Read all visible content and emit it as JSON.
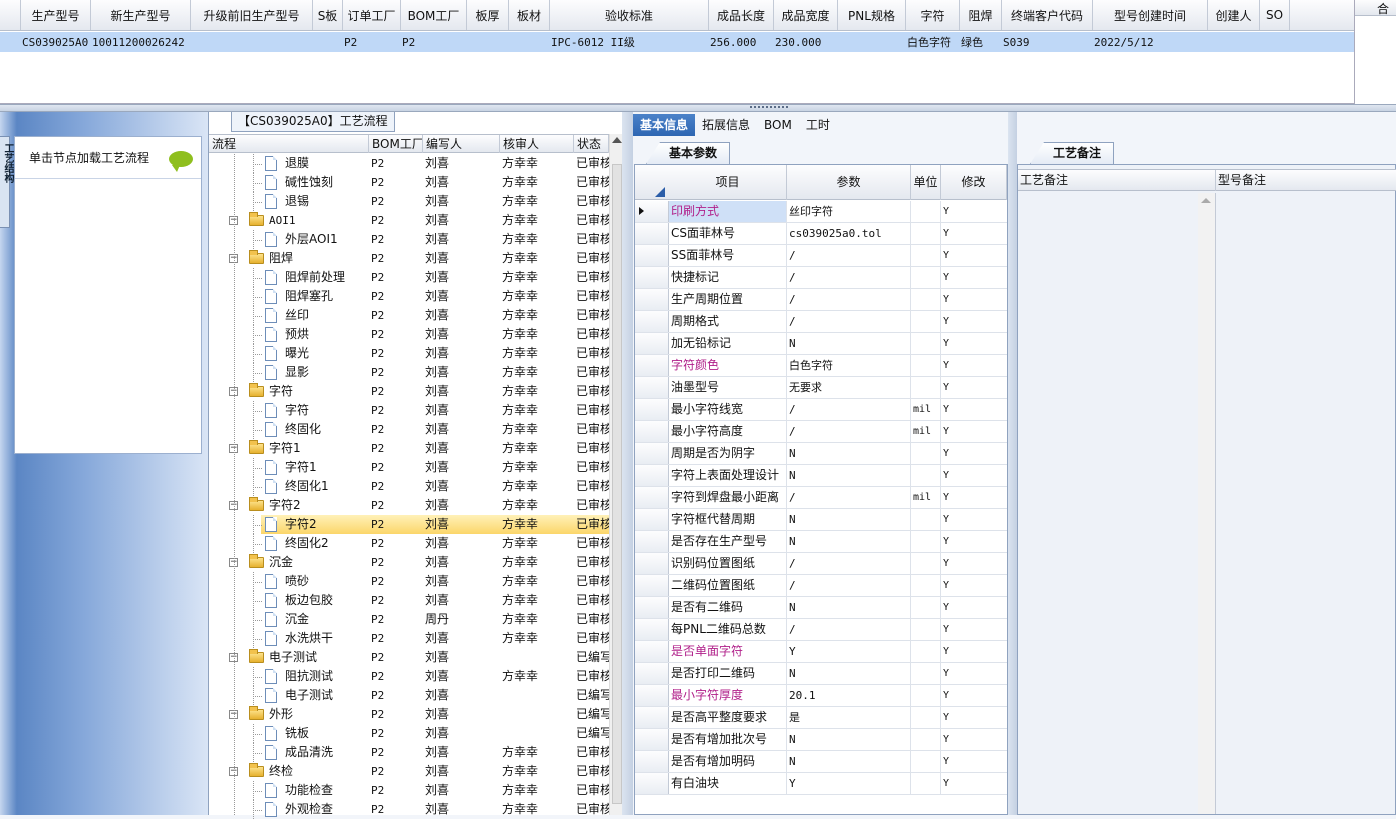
{
  "top_grid": {
    "columns": [
      "生产型号",
      "新生产型号",
      "升级前旧生产型号",
      "S板",
      "订单工厂",
      "BOM工厂",
      "板厚",
      "板材",
      "验收标准",
      "成品长度",
      "成品宽度",
      "PNL规格",
      "字符",
      "阻焊",
      "终端客户代码",
      "型号创建时间",
      "创建人",
      "SO"
    ],
    "row": [
      "CS039025A0",
      "10011200026242",
      "",
      "",
      "P2",
      "P2",
      "",
      "",
      "IPC-6012 II级",
      "256.000",
      "230.000",
      "",
      "白色字符",
      "绿色",
      "S039",
      "2022/5/12",
      "",
      ""
    ],
    "right_header": "合"
  },
  "left_panel": {
    "side_tab": "工艺结构",
    "hint": "单击节点加载工艺流程"
  },
  "tree": {
    "title": "【CS039025A0】工艺流程",
    "columns": [
      "流程",
      "BOM工厂",
      "编写人",
      "核审人",
      "状态"
    ],
    "rows": [
      {
        "level": 2,
        "type": "doc",
        "name": "退膜",
        "bom": "P2",
        "writer": "刘喜",
        "reviewer": "方幸幸",
        "status": "已审核"
      },
      {
        "level": 2,
        "type": "doc",
        "name": "碱性蚀刻",
        "bom": "P2",
        "writer": "刘喜",
        "reviewer": "方幸幸",
        "status": "已审核"
      },
      {
        "level": 2,
        "type": "doc",
        "name": "退锡",
        "bom": "P2",
        "writer": "刘喜",
        "reviewer": "方幸幸",
        "status": "已审核"
      },
      {
        "level": 1,
        "type": "folder",
        "name": "AOI1",
        "bom": "P2",
        "writer": "刘喜",
        "reviewer": "方幸幸",
        "status": "已审核"
      },
      {
        "level": 2,
        "type": "doc",
        "name": "外层AOI1",
        "bom": "P2",
        "writer": "刘喜",
        "reviewer": "方幸幸",
        "status": "已审核"
      },
      {
        "level": 1,
        "type": "folder",
        "name": "阻焊",
        "bom": "P2",
        "writer": "刘喜",
        "reviewer": "方幸幸",
        "status": "已审核"
      },
      {
        "level": 2,
        "type": "doc",
        "name": "阻焊前处理",
        "bom": "P2",
        "writer": "刘喜",
        "reviewer": "方幸幸",
        "status": "已审核"
      },
      {
        "level": 2,
        "type": "doc",
        "name": "阻焊塞孔",
        "bom": "P2",
        "writer": "刘喜",
        "reviewer": "方幸幸",
        "status": "已审核"
      },
      {
        "level": 2,
        "type": "doc",
        "name": "丝印",
        "bom": "P2",
        "writer": "刘喜",
        "reviewer": "方幸幸",
        "status": "已审核"
      },
      {
        "level": 2,
        "type": "doc",
        "name": "预烘",
        "bom": "P2",
        "writer": "刘喜",
        "reviewer": "方幸幸",
        "status": "已审核"
      },
      {
        "level": 2,
        "type": "doc",
        "name": "曝光",
        "bom": "P2",
        "writer": "刘喜",
        "reviewer": "方幸幸",
        "status": "已审核"
      },
      {
        "level": 2,
        "type": "doc",
        "name": "显影",
        "bom": "P2",
        "writer": "刘喜",
        "reviewer": "方幸幸",
        "status": "已审核"
      },
      {
        "level": 1,
        "type": "folder",
        "name": "字符",
        "bom": "P2",
        "writer": "刘喜",
        "reviewer": "方幸幸",
        "status": "已审核"
      },
      {
        "level": 2,
        "type": "doc",
        "name": "字符",
        "bom": "P2",
        "writer": "刘喜",
        "reviewer": "方幸幸",
        "status": "已审核"
      },
      {
        "level": 2,
        "type": "doc",
        "name": "终固化",
        "bom": "P2",
        "writer": "刘喜",
        "reviewer": "方幸幸",
        "status": "已审核"
      },
      {
        "level": 1,
        "type": "folder",
        "name": "字符1",
        "bom": "P2",
        "writer": "刘喜",
        "reviewer": "方幸幸",
        "status": "已审核"
      },
      {
        "level": 2,
        "type": "doc",
        "name": "字符1",
        "bom": "P2",
        "writer": "刘喜",
        "reviewer": "方幸幸",
        "status": "已审核"
      },
      {
        "level": 2,
        "type": "doc",
        "name": "终固化1",
        "bom": "P2",
        "writer": "刘喜",
        "reviewer": "方幸幸",
        "status": "已审核"
      },
      {
        "level": 1,
        "type": "folder",
        "name": "字符2",
        "bom": "P2",
        "writer": "刘喜",
        "reviewer": "方幸幸",
        "status": "已审核"
      },
      {
        "level": 2,
        "type": "doc",
        "name": "字符2",
        "bom": "P2",
        "writer": "刘喜",
        "reviewer": "方幸幸",
        "status": "已审核",
        "selected": true
      },
      {
        "level": 2,
        "type": "doc",
        "name": "终固化2",
        "bom": "P2",
        "writer": "刘喜",
        "reviewer": "方幸幸",
        "status": "已审核"
      },
      {
        "level": 1,
        "type": "folder",
        "name": "沉金",
        "bom": "P2",
        "writer": "刘喜",
        "reviewer": "方幸幸",
        "status": "已审核"
      },
      {
        "level": 2,
        "type": "doc",
        "name": "喷砂",
        "bom": "P2",
        "writer": "刘喜",
        "reviewer": "方幸幸",
        "status": "已审核"
      },
      {
        "level": 2,
        "type": "doc",
        "name": "板边包胶",
        "bom": "P2",
        "writer": "刘喜",
        "reviewer": "方幸幸",
        "status": "已审核"
      },
      {
        "level": 2,
        "type": "doc",
        "name": "沉金",
        "bom": "P2",
        "writer": "周丹",
        "reviewer": "方幸幸",
        "status": "已审核"
      },
      {
        "level": 2,
        "type": "doc",
        "name": "水洗烘干",
        "bom": "P2",
        "writer": "刘喜",
        "reviewer": "方幸幸",
        "status": "已审核"
      },
      {
        "level": 1,
        "type": "folder",
        "name": "电子测试",
        "bom": "P2",
        "writer": "刘喜",
        "reviewer": "",
        "status": "已编写"
      },
      {
        "level": 2,
        "type": "doc",
        "name": "阻抗测试",
        "bom": "P2",
        "writer": "刘喜",
        "reviewer": "方幸幸",
        "status": "已审核"
      },
      {
        "level": 2,
        "type": "doc",
        "name": "电子测试",
        "bom": "P2",
        "writer": "刘喜",
        "reviewer": "",
        "status": "已编写"
      },
      {
        "level": 1,
        "type": "folder",
        "name": "外形",
        "bom": "P2",
        "writer": "刘喜",
        "reviewer": "",
        "status": "已编写"
      },
      {
        "level": 2,
        "type": "doc",
        "name": "铣板",
        "bom": "P2",
        "writer": "刘喜",
        "reviewer": "",
        "status": "已编写"
      },
      {
        "level": 2,
        "type": "doc",
        "name": "成品清洗",
        "bom": "P2",
        "writer": "刘喜",
        "reviewer": "方幸幸",
        "status": "已审核"
      },
      {
        "level": 1,
        "type": "folder",
        "name": "终检",
        "bom": "P2",
        "writer": "刘喜",
        "reviewer": "方幸幸",
        "status": "已审核"
      },
      {
        "level": 2,
        "type": "doc",
        "name": "功能检查",
        "bom": "P2",
        "writer": "刘喜",
        "reviewer": "方幸幸",
        "status": "已审核"
      },
      {
        "level": 2,
        "type": "doc",
        "name": "外观检查",
        "bom": "P2",
        "writer": "刘喜",
        "reviewer": "方幸幸",
        "status": "已审核"
      }
    ]
  },
  "tabs": [
    "基本信息",
    "拓展信息",
    "BOM",
    "工时"
  ],
  "params": {
    "section_title": "基本参数",
    "columns": [
      "项目",
      "参数",
      "单位",
      "修改"
    ],
    "rows": [
      {
        "item": "印刷方式",
        "value": "丝印字符",
        "unit": "",
        "edit": "Y",
        "highlight": true,
        "current": true
      },
      {
        "item": "CS面菲林号",
        "value": "cs039025a0.tol",
        "unit": "",
        "edit": "Y"
      },
      {
        "item": "SS面菲林号",
        "value": "/",
        "unit": "",
        "edit": "Y"
      },
      {
        "item": "快捷标记",
        "value": "/",
        "unit": "",
        "edit": "Y"
      },
      {
        "item": "生产周期位置",
        "value": "/",
        "unit": "",
        "edit": "Y"
      },
      {
        "item": "周期格式",
        "value": "/",
        "unit": "",
        "edit": "Y"
      },
      {
        "item": "加无铅标记",
        "value": "N",
        "unit": "",
        "edit": "Y"
      },
      {
        "item": "字符颜色",
        "value": "白色字符",
        "unit": "",
        "edit": "Y",
        "highlight": true
      },
      {
        "item": "油墨型号",
        "value": "无要求",
        "unit": "",
        "edit": "Y"
      },
      {
        "item": "最小字符线宽",
        "value": "/",
        "unit": "mil",
        "edit": "Y"
      },
      {
        "item": "最小字符高度",
        "value": "/",
        "unit": "mil",
        "edit": "Y"
      },
      {
        "item": "周期是否为阴字",
        "value": "N",
        "unit": "",
        "edit": "Y"
      },
      {
        "item": "字符上表面处理设计",
        "value": "N",
        "unit": "",
        "edit": "Y"
      },
      {
        "item": "字符到焊盘最小距离",
        "value": "/",
        "unit": "mil",
        "edit": "Y"
      },
      {
        "item": "字符框代替周期",
        "value": "N",
        "unit": "",
        "edit": "Y"
      },
      {
        "item": "是否存在生产型号",
        "value": "N",
        "unit": "",
        "edit": "Y"
      },
      {
        "item": "识别码位置图纸",
        "value": "/",
        "unit": "",
        "edit": "Y"
      },
      {
        "item": "二维码位置图纸",
        "value": "/",
        "unit": "",
        "edit": "Y"
      },
      {
        "item": "是否有二维码",
        "value": "N",
        "unit": "",
        "edit": "Y"
      },
      {
        "item": "每PNL二维码总数",
        "value": "/",
        "unit": "",
        "edit": "Y"
      },
      {
        "item": "是否单面字符",
        "value": "Y",
        "unit": "",
        "edit": "Y",
        "highlight": true
      },
      {
        "item": "是否打印二维码",
        "value": "N",
        "unit": "",
        "edit": "Y"
      },
      {
        "item": "最小字符厚度",
        "value": "20.1",
        "unit": "",
        "edit": "Y",
        "highlight": true
      },
      {
        "item": "是否高平整度要求",
        "value": "是",
        "unit": "",
        "edit": "Y"
      },
      {
        "item": "是否有增加批次号",
        "value": "N",
        "unit": "",
        "edit": "Y"
      },
      {
        "item": "是否有增加明码",
        "value": "N",
        "unit": "",
        "edit": "Y"
      },
      {
        "item": "有白油块",
        "value": "Y",
        "unit": "",
        "edit": "Y"
      }
    ]
  },
  "notes": {
    "section_title": "工艺备注",
    "columns": [
      "工艺备注",
      "型号备注"
    ]
  },
  "colors": {
    "accent": "#2e66b2",
    "selected_row": "#bfd8f7",
    "highlight_text": "#b0208a"
  }
}
